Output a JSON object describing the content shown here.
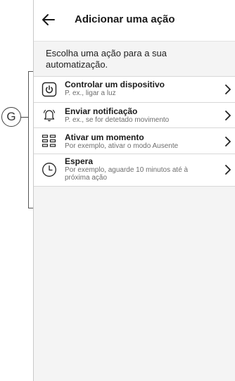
{
  "header": {
    "title": "Adicionar uma ação",
    "back_icon": "arrow-left-icon"
  },
  "intro_text": "Escolha uma ação para a sua automatização.",
  "callout_label": "G",
  "actions": [
    {
      "label": "Controlar um dispositivo",
      "sub": "P. ex., ligar a luz",
      "icon": "power-icon"
    },
    {
      "label": "Enviar notificação",
      "sub": "P. ex., se for detetado movimento",
      "icon": "bell-ringing-icon"
    },
    {
      "label": "Ativar um momento",
      "sub": "Por exemplo, ativar o modo Ausente",
      "icon": "moment-grid-icon"
    },
    {
      "label": "Espera",
      "sub": "Por exemplo, aguarde 10 minutos até à próxima ação",
      "icon": "clock-icon"
    }
  ],
  "colors": {
    "background": "#f4f4f4",
    "card": "#ffffff",
    "text": "#1a1a1a",
    "subtext": "#6e6e6e"
  }
}
